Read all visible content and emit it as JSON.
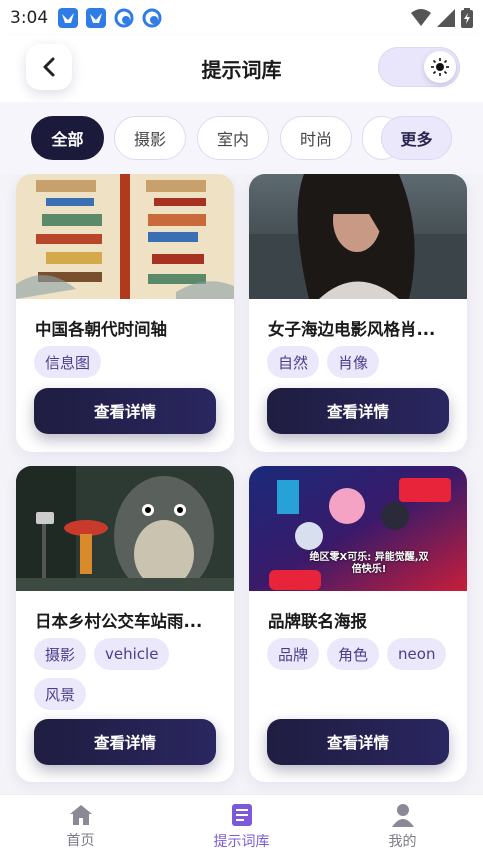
{
  "status": {
    "time": "3:04"
  },
  "header": {
    "title": "提示词库"
  },
  "filters": [
    {
      "label": "全部",
      "active": true
    },
    {
      "label": "摄影",
      "active": false
    },
    {
      "label": "室内",
      "active": false
    },
    {
      "label": "时尚",
      "active": false
    }
  ],
  "more_label": "更多",
  "cards": [
    {
      "title": "中国各朝代时间轴",
      "tags": [
        "信息图"
      ],
      "button": "查看详情"
    },
    {
      "title": "女子海边电影风格肖...",
      "tags": [
        "自然",
        "肖像"
      ],
      "button": "查看详情"
    },
    {
      "title": "日本乡村公交车站雨...",
      "tags": [
        "摄影",
        "vehicle",
        "风景"
      ],
      "button": "查看详情"
    },
    {
      "title": "品牌联名海报",
      "tags": [
        "品牌",
        "角色",
        "neon"
      ],
      "button": "查看详情",
      "image_text": "绝区零X可乐: 异能觉醒,双倍快乐!"
    }
  ],
  "nav": [
    {
      "label": "首页",
      "icon": "home-icon",
      "active": false
    },
    {
      "label": "提示词库",
      "icon": "library-icon",
      "active": true
    },
    {
      "label": "我的",
      "icon": "profile-icon",
      "active": false
    }
  ],
  "colors": {
    "accent": "#7a5ad8",
    "dark_button": "#1f1d40",
    "tag_bg": "#ece8fb"
  }
}
